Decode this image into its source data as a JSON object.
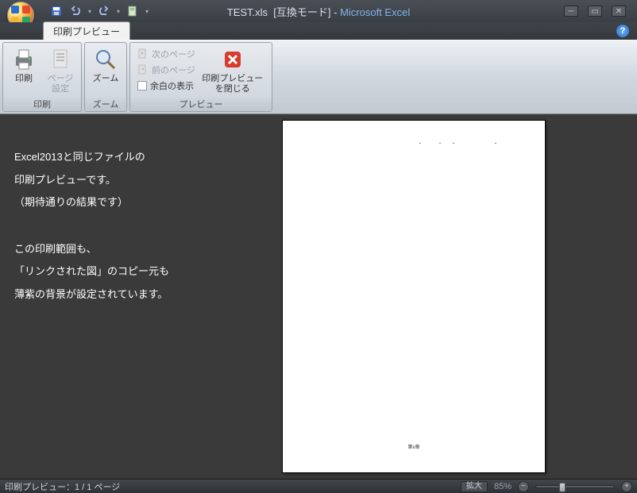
{
  "title": {
    "file": "TEST.xls",
    "mode": "[互換モード]",
    "app": "Microsoft Excel"
  },
  "qat": {
    "save": "save",
    "undo": "undo",
    "redo": "redo",
    "extra": "quick-print"
  },
  "tab": {
    "label": "印刷プレビュー"
  },
  "ribbon": {
    "print": {
      "label": "印刷",
      "print_btn": "印刷",
      "page_setup_btn": "ページ\n設定"
    },
    "zoom": {
      "label": "ズーム",
      "zoom_btn": "ズーム"
    },
    "preview": {
      "label": "プレビュー",
      "next_page": "次のページ",
      "prev_page": "前のページ",
      "margins": "余白の表示",
      "close_btn": "印刷プレビュー\nを閉じる"
    }
  },
  "explain": {
    "l1": "Excel2013と同じファイルの",
    "l2": "印刷プレビューです。",
    "l3": "（期待通りの結果です）",
    "l4": "この印刷範囲も、",
    "l5": "「リンクされた図」のコピー元も",
    "l6": "薄紫の背景が設定されています。"
  },
  "page_content": {
    "footer_mark": "第x章"
  },
  "status": {
    "left": "印刷プレビュー：1 / 1 ページ",
    "zoom_label": "拡大",
    "zoom_pct": "85%"
  }
}
